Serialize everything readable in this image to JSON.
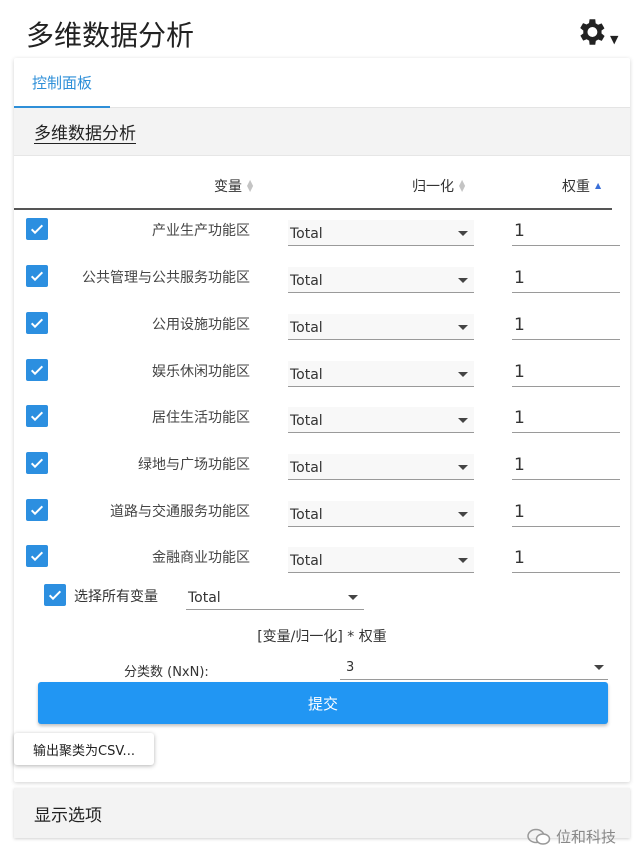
{
  "header": {
    "title": "多维数据分析"
  },
  "tabs": [
    {
      "label": "控制面板"
    }
  ],
  "section": {
    "title": "多维数据分析"
  },
  "table": {
    "columns": {
      "variable": "变量",
      "normalize": "归一化",
      "weight": "权重"
    },
    "rows": [
      {
        "name": "产业生产功能区",
        "normalize": "Total",
        "weight": "1"
      },
      {
        "name": "公共管理与公共服务功能区",
        "normalize": "Total",
        "weight": "1"
      },
      {
        "name": "公用设施功能区",
        "normalize": "Total",
        "weight": "1"
      },
      {
        "name": "娱乐休闲功能区",
        "normalize": "Total",
        "weight": "1"
      },
      {
        "name": "居住生活功能区",
        "normalize": "Total",
        "weight": "1"
      },
      {
        "name": "绿地与广场功能区",
        "normalize": "Total",
        "weight": "1"
      },
      {
        "name": "道路与交通服务功能区",
        "normalize": "Total",
        "weight": "1"
      },
      {
        "name": "金融商业功能区",
        "normalize": "Total",
        "weight": "1"
      }
    ]
  },
  "select_all": {
    "label": "选择所有变量",
    "normalize": "Total"
  },
  "formula": "[变量/归一化] * 权重",
  "clusters": {
    "label": "分类数 (NxN):",
    "value": "3"
  },
  "submit_label": "提交",
  "export_label": "输出聚类为CSV...",
  "display_options": {
    "title": "显示选项"
  },
  "watermark": "位和科技",
  "colors": {
    "accent": "#2196f3",
    "checkbox": "#2c8fe0",
    "tab": "#2e8fd8"
  }
}
